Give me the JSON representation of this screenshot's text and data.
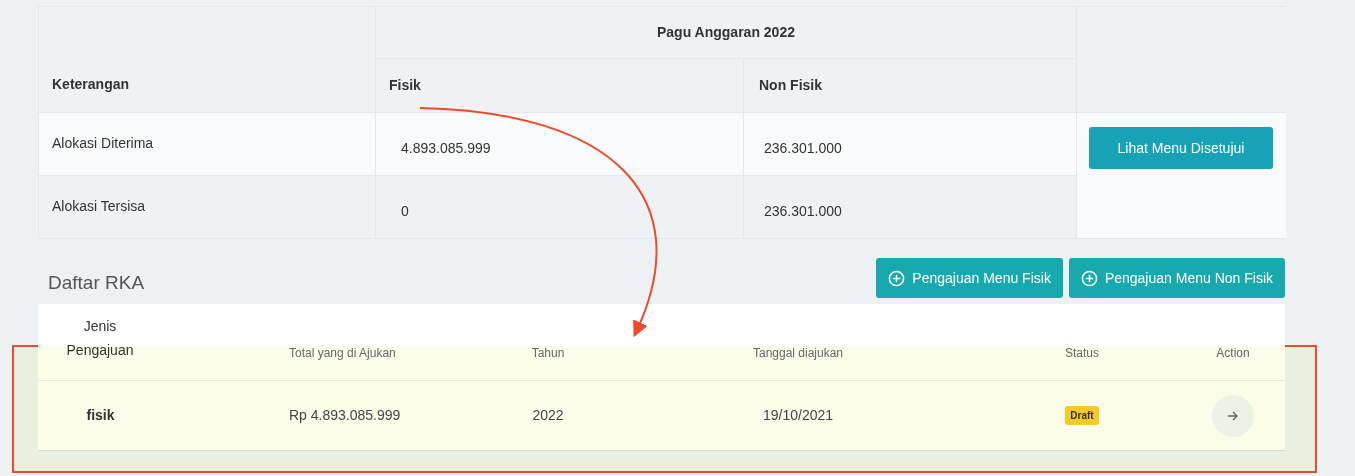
{
  "budget_table": {
    "group_header": "Pagu Anggaran 2022",
    "columns": [
      "Keterangan",
      "Fisik",
      "Non Fisik"
    ],
    "rows": [
      {
        "label": "Alokasi Diterima",
        "fisik": "4.893.085.999",
        "non_fisik": "236.301.000"
      },
      {
        "label": "Alokasi Tersisa",
        "fisik": "0",
        "non_fisik": "236.301.000"
      }
    ],
    "button": "Lihat Menu Disetujui"
  },
  "rka": {
    "title": "Daftar RKA",
    "buttons": [
      "Pengajuan Menu Fisik",
      "Pengajuan Menu Non Fisik"
    ],
    "columns": [
      "Jenis Pengajuan",
      "Total yang di Ajukan",
      "Tahun",
      "Tanggal diajukan",
      "Status",
      "Action"
    ],
    "rows": [
      {
        "jenis": "fisik",
        "total": "Rp 4.893.085.999",
        "tahun": "2022",
        "tanggal": "19/10/2021",
        "status": "Draft"
      }
    ]
  }
}
